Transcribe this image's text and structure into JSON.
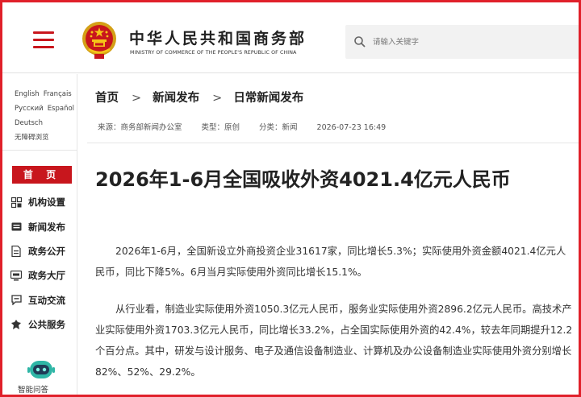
{
  "header": {
    "logo_cn": "中华人民共和国商务部",
    "logo_en": "MINISTRY OF COMMERCE OF THE PEOPLE'S REPUBLIC OF CHINA",
    "search_placeholder": "请输入关键字",
    "menu_icon": "hamburger-icon",
    "brand_color": "#c8161d"
  },
  "sidebar": {
    "languages": [
      "English",
      "Français",
      "Русский",
      "Español",
      "Deutsch",
      "无障碍浏览"
    ],
    "home_label": "首 页",
    "items": [
      {
        "label": "机构设置",
        "icon": "org-grid-icon"
      },
      {
        "label": "新闻发布",
        "icon": "news-icon"
      },
      {
        "label": "政务公开",
        "icon": "document-icon"
      },
      {
        "label": "政务大厅",
        "icon": "hall-icon"
      },
      {
        "label": "互动交流",
        "icon": "chat-icon"
      },
      {
        "label": "公共服务",
        "icon": "service-icon"
      }
    ],
    "assistant_label": "智能问答"
  },
  "breadcrumb": [
    "首页",
    "新闻发布",
    "日常新闻发布"
  ],
  "meta": {
    "source": "来源：商务部新闻办公室",
    "type": "类型：原创",
    "category": "分类：新闻",
    "datetime": "2026-07-23 16:49"
  },
  "article": {
    "title": "2026年1-6月全国吸收外资4021.4亿元人民币",
    "p1": "2026年1-6月，全国新设立外商投资企业31617家，同比增长5.3%；实际使用外资金额4021.4亿元人民币，同比下降5%。6月当月实际使用外资同比增长15.1%。",
    "p2_before": "从行业看，制造业实际使用外资1050.3亿元人民币，服务业实际使用外资2896.2亿元人民币。",
    "p2_highlight": "高技术产业实际使用外资1703.3亿元人民币，同比增长33.2%，占全国实际使用外资的42.4%",
    "p2_after": "，较去年同期提升12.2个百分点。其中，研发与设计服务、电子及通信设备制造业、计算机及办公设备制造业实际使用外资分别增长82%、52%、29.2%。",
    "highlight_color": "#e0202a"
  }
}
